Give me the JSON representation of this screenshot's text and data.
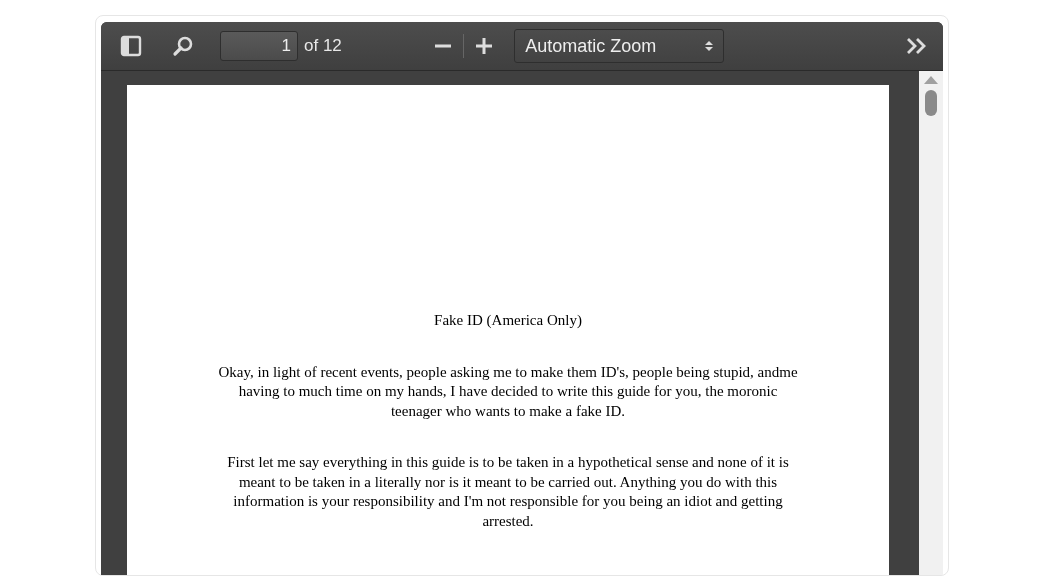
{
  "toolbar": {
    "page_number": "1",
    "page_count": "of 12",
    "zoom": "Automatic Zoom"
  },
  "document": {
    "title": "Fake ID (America Only)",
    "paragraphs": [
      "Okay, in light of recent events, people asking me to make them ID's, people being stupid, andme having to much time on my hands, I have decided to write this guide for you, the moronic teenager who wants to make a fake ID.",
      "First let me say everything in this guide is to be taken in a hypothetical sense and none of it is meant to be taken in a literally nor is it meant to be carried out. Anything you do with this information is your responsibility and I'm not responsible for you being an idiot and getting arrested."
    ]
  }
}
